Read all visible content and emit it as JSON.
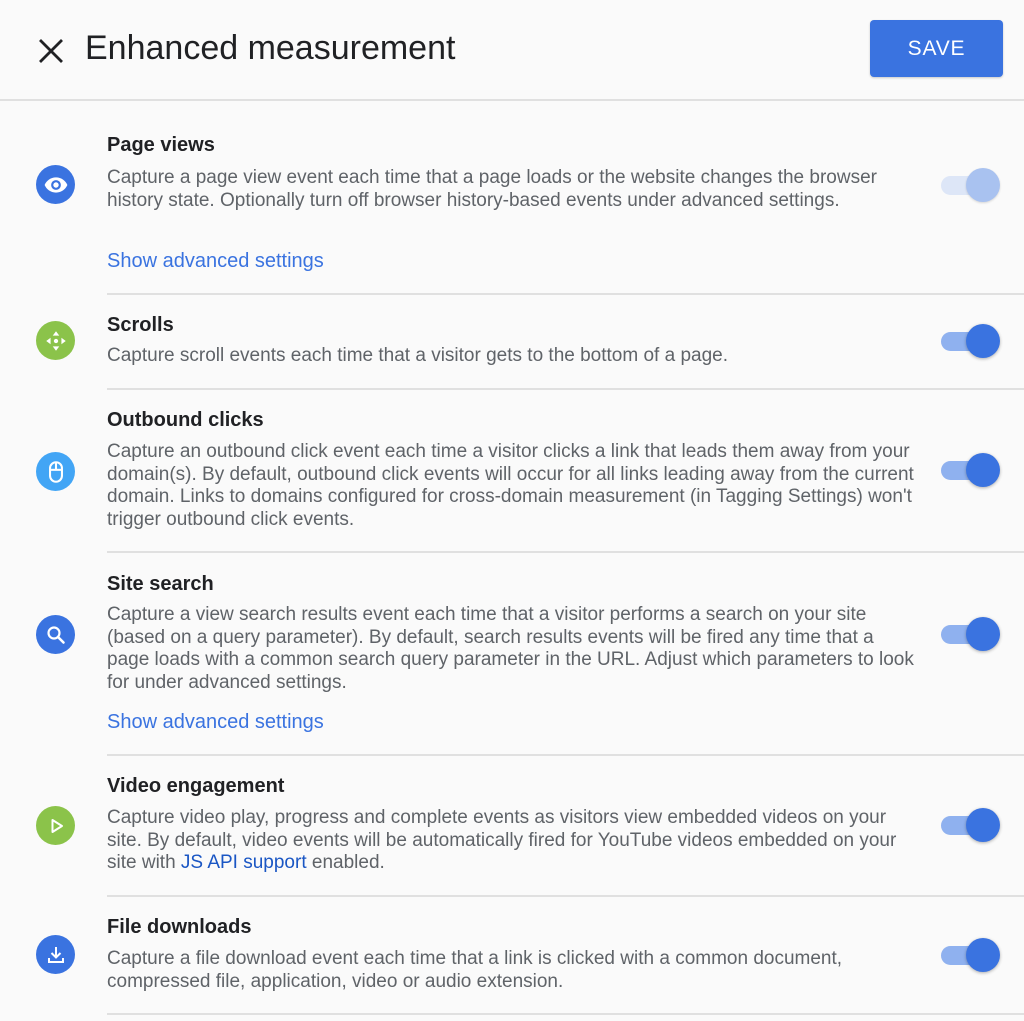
{
  "header": {
    "close_icon": "close-icon",
    "title": "Enhanced measurement",
    "save_label": "SAVE"
  },
  "colors": {
    "accent": "#3a73e0",
    "toggle_track": "#8fb1ef",
    "icon_blue": "#3a73e0",
    "icon_green": "#8bc34a",
    "icon_light_blue": "#42a5f5"
  },
  "sections": [
    {
      "title": "Page views",
      "icon": "eye-icon",
      "description": "Capture a page view event each time that a page loads or the website changes the browser history state. Optionally turn off browser history-based events under advanced settings.",
      "advanced_link": "Show advanced settings",
      "enabled": true,
      "toggle_disabled": true
    },
    {
      "title": "Scrolls",
      "icon": "scroll-arrows-icon",
      "description": "Capture scroll events each time that a visitor gets to the bottom of a page.",
      "enabled": true
    },
    {
      "title": "Outbound clicks",
      "icon": "mouse-icon",
      "description": "Capture an outbound click event each time a visitor clicks a link that leads them away from your domain(s). By default, outbound click events will occur for all links leading away from the current domain. Links to domains configured for cross-domain measurement (in Tagging Settings) won't trigger outbound click events.",
      "enabled": true
    },
    {
      "title": "Site search",
      "icon": "search-icon",
      "description": "Capture a view search results event each time that a visitor performs a search on your site (based on a query parameter). By default, search results events will be fired any time that a page loads with a common search query parameter in the URL. Adjust which parameters to look for under advanced settings.",
      "advanced_link": "Show advanced settings",
      "enabled": true
    },
    {
      "title": "Video engagement",
      "icon": "play-icon",
      "description_before": "Capture video play, progress and complete events as visitors view embedded videos on your site. By default, video events will be automatically fired for YouTube videos embedded on your site with ",
      "description_link": "JS API support",
      "description_after": " enabled.",
      "enabled": true
    },
    {
      "title": "File downloads",
      "icon": "download-icon",
      "description": "Capture a file download event each time that a link is clicked with a common document, compressed file, application, video or audio extension.",
      "enabled": true
    }
  ]
}
